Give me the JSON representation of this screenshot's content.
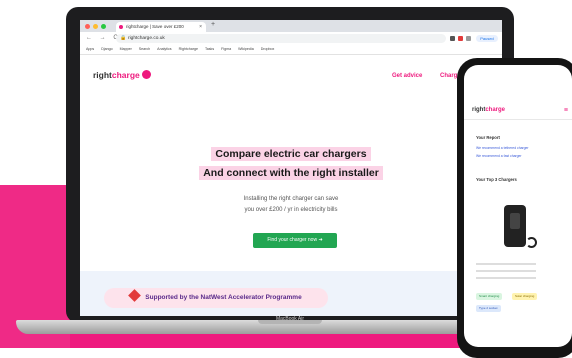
{
  "browser": {
    "tab_title": "rightcharge | Save over £200",
    "new_tab": "+",
    "url": "rightcharge.co.uk",
    "nav_icons": "← → C",
    "pause_label": "Paused",
    "bookmarks": [
      "Apps",
      "Django",
      "Mapper",
      "Search",
      "Analytics",
      "Rightcharge",
      "Tasks",
      "Figma",
      "Wikipedia",
      "Dropbox"
    ],
    "colors": {
      "close": "#ff5f57",
      "minimize": "#febc2e",
      "maximize": "#28c840"
    }
  },
  "site": {
    "logo_prefix": "right",
    "logo_accent": "charge",
    "nav": {
      "get_advice": "Get advice",
      "chargers": "Charg"
    },
    "headline_line1": "Compare electric car chargers",
    "headline_line2": "And connect with the right installer",
    "subtext_line1": "Installing the right charger can save",
    "subtext_line2": "you over £200 / yr in electricity bills",
    "cta_label": "Find your charger now",
    "natwest_text": "Supported by the NatWest Accelerator Programme",
    "brand_color": "#ee1a7e",
    "cta_color": "#22a652"
  },
  "laptop": {
    "model_label": "MacBook Air"
  },
  "phone": {
    "logo_prefix": "right",
    "logo_accent": "charge",
    "report_heading": "Your Report",
    "link1": "We recommend a tethered charger",
    "link2": "We recommend a fast charger",
    "top_chargers_heading": "Your Top 3 Chargers",
    "tags": [
      "Smart charging",
      "Solar charging",
      "Type 2 socket"
    ]
  }
}
